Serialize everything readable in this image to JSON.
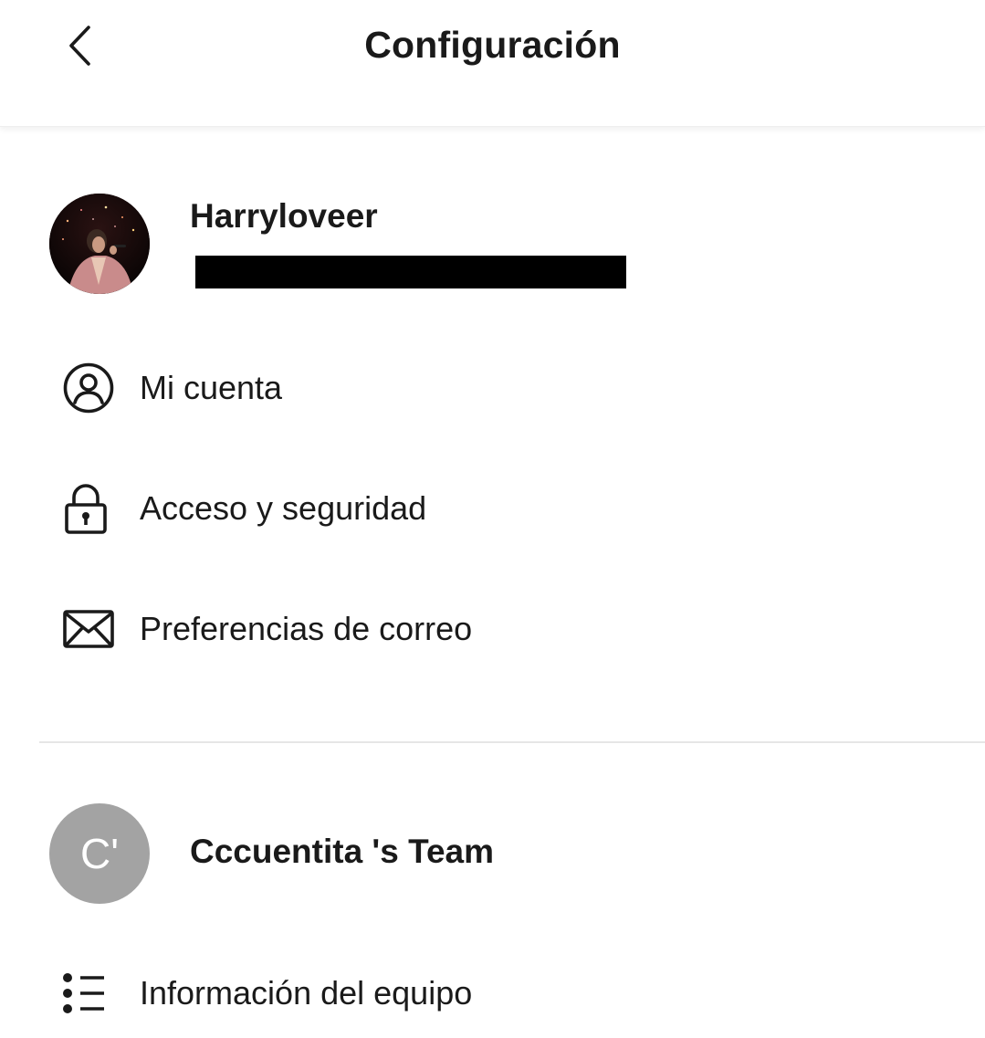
{
  "header": {
    "title": "Configuración",
    "back_icon": "chevron-left-icon"
  },
  "profile": {
    "name": "Harryloveer",
    "email_redacted": true
  },
  "account_menu": [
    {
      "label": "Mi cuenta",
      "icon": "user-circle-icon"
    },
    {
      "label": "Acceso y seguridad",
      "icon": "lock-icon"
    },
    {
      "label": "Preferencias de correo",
      "icon": "mail-icon"
    }
  ],
  "team": {
    "avatar_initials": "C'",
    "name": "Cccuentita 's Team",
    "avatar_color": "#a3a3a3"
  },
  "team_menu": [
    {
      "label": "Información del equipo",
      "icon": "list-icon"
    }
  ],
  "colors": {
    "text": "#1a1a1a",
    "divider": "#e6e6e6",
    "background": "#ffffff"
  }
}
